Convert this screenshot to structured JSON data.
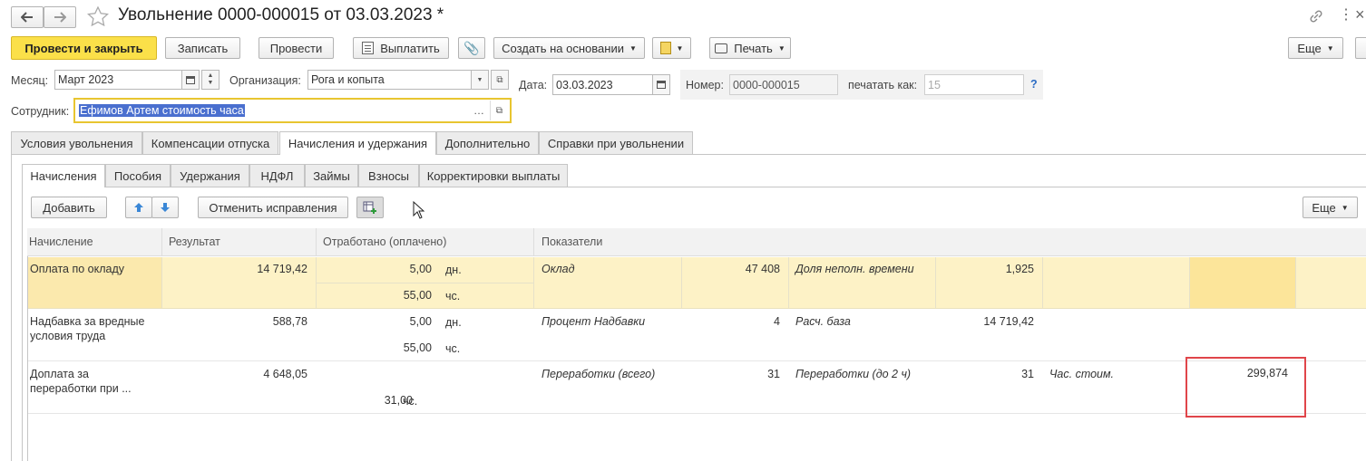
{
  "window": {
    "title": "Увольнение 0000-000015 от 03.03.2023 *"
  },
  "toolbar": {
    "post_close": "Провести и закрыть",
    "save": "Записать",
    "post": "Провести",
    "pay": "Выплатить",
    "create_based": "Создать на основании",
    "print": "Печать",
    "more": "Еще"
  },
  "form": {
    "month_label": "Месяц:",
    "month_value": "Март 2023",
    "org_label": "Организация:",
    "org_value": "Рога и копыта",
    "date_label": "Дата:",
    "date_value": "03.03.2023",
    "number_label": "Номер:",
    "number_value": "0000-000015",
    "print_as_label": "печатать как:",
    "print_as_value": "15",
    "help": "?",
    "employee_label": "Сотрудник:",
    "employee_value": "Ефимов Артем стоимость часа"
  },
  "tabs": [
    "Условия увольнения",
    "Компенсации отпуска",
    "Начисления и удержания",
    "Дополнительно",
    "Справки при увольнении"
  ],
  "subtabs": [
    "Начисления",
    "Пособия",
    "Удержания",
    "НДФЛ",
    "Займы",
    "Взносы",
    "Корректировки выплаты"
  ],
  "subtoolbar": {
    "add": "Добавить",
    "cancel_fix": "Отменить исправления",
    "more": "Еще"
  },
  "table": {
    "headers": {
      "accrual": "Начисление",
      "result": "Результат",
      "worked": "Отработано (оплачено)",
      "indicators": "Показатели"
    },
    "rows": [
      {
        "name_line1": "Оплата по окладу",
        "name_line2": "",
        "result": "14 719,42",
        "days": "5,00",
        "days_unit": "дн.",
        "hours": "55,00",
        "hours_unit": "чс.",
        "ind1_name": "Оклад",
        "ind1_val": "47 408",
        "ind2_name": "Доля неполн. времени",
        "ind2_val": "1,925",
        "ind3_name": "",
        "ind3_val": ""
      },
      {
        "name_line1": "Надбавка за вредные",
        "name_line2": "условия труда",
        "result": "588,78",
        "days": "5,00",
        "days_unit": "дн.",
        "hours": "55,00",
        "hours_unit": "чс.",
        "ind1_name": "Процент Надбавки",
        "ind1_val": "4",
        "ind2_name": "Расч. база",
        "ind2_val": "14 719,42",
        "ind3_name": "",
        "ind3_val": ""
      },
      {
        "name_line1": "Доплата за",
        "name_line2": "переработки при ...",
        "result": "4 648,05",
        "days": "",
        "days_unit": "",
        "hours": "31,00",
        "hours_unit": "чс.",
        "ind1_name": "Переработки (всего)",
        "ind1_val": "31",
        "ind2_name": "Переработки (до 2 ч)",
        "ind2_val": "31",
        "ind3_name": "Час. стоим.",
        "ind3_val": "299,874"
      }
    ]
  },
  "colors": {
    "primary": "#fbe049",
    "selected_row": "#fdf2c6",
    "highlight_box": "#e0454a",
    "employee_border": "#e8c530",
    "selection": "#4a6fcf"
  }
}
